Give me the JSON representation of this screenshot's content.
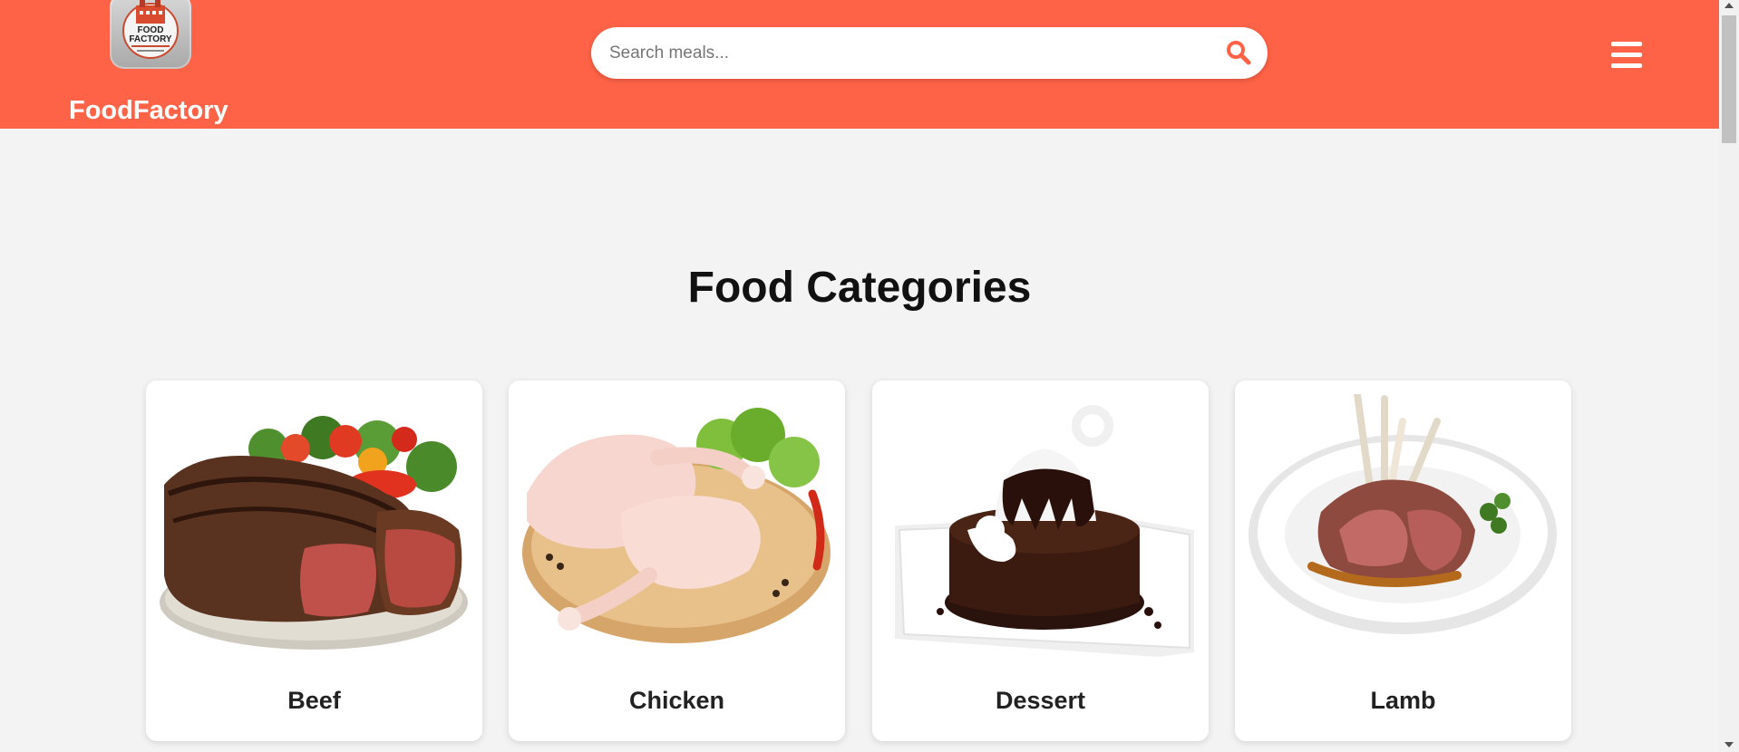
{
  "header": {
    "brand": "FoodFactory",
    "logo_icon": "food-factory-logo",
    "logo_text_line1": "FOOD",
    "logo_text_line2": "FACTORY",
    "search_placeholder": "Search meals...",
    "search_value": "",
    "search_icon": "search-icon",
    "menu_icon": "hamburger-menu-icon"
  },
  "main": {
    "title": "Food Categories",
    "categories": [
      {
        "label": "Beef",
        "image": "beef-steak-image"
      },
      {
        "label": "Chicken",
        "image": "chicken-legs-image"
      },
      {
        "label": "Dessert",
        "image": "chocolate-dessert-image"
      },
      {
        "label": "Lamb",
        "image": "lamb-chops-image"
      }
    ]
  },
  "colors": {
    "header_bg": "#ff6347",
    "page_bg": "#f3f3f3",
    "card_bg": "#ffffff",
    "accent": "#ff6347"
  }
}
